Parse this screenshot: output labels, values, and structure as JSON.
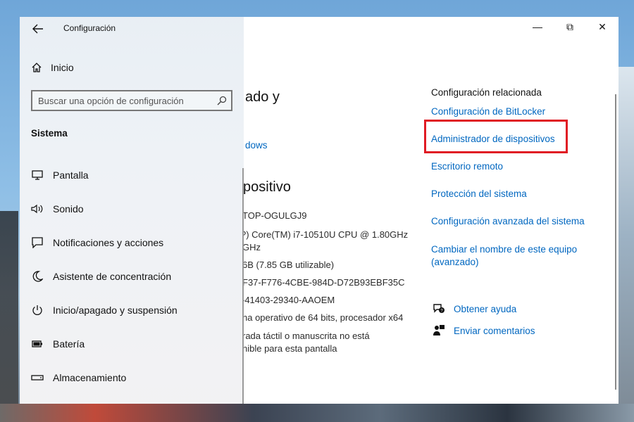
{
  "window": {
    "title": "Configuración",
    "controls": {
      "minimize": "—",
      "maximize": "⧉",
      "close": "✕"
    }
  },
  "sidebar": {
    "home_label": "Inicio",
    "search": {
      "placeholder": "Buscar una opción de configuración"
    },
    "section_title": "Sistema",
    "items": [
      {
        "label": "Pantalla",
        "icon": "monitor-icon"
      },
      {
        "label": "Sonido",
        "icon": "speaker-icon"
      },
      {
        "label": "Notificaciones y acciones",
        "icon": "notification-icon"
      },
      {
        "label": "Asistente de concentración",
        "icon": "moon-icon"
      },
      {
        "label": "Inicio/apagado y suspensión",
        "icon": "power-icon"
      },
      {
        "label": "Batería",
        "icon": "battery-icon"
      },
      {
        "label": "Almacenamiento",
        "icon": "storage-icon"
      }
    ]
  },
  "main": {
    "heading_partial": "ado y",
    "link_partial": "dows",
    "device_heading_partial": "positivo",
    "specs": [
      "TOP-OGULGJ9",
      "?) Core(TM) i7-10510U CPU @ 1.80GHz",
      "GHz",
      "6B (7.85 GB utilizable)",
      "F37-F776-4CBE-984D-D72B93EBF35C",
      "-41403-29340-AAOEM",
      "na operativo de 64 bits, procesador x64",
      "rada táctil o manuscrita no está",
      "nible para esta pantalla"
    ]
  },
  "related": {
    "title": "Configuración relacionada",
    "links": [
      "Configuración de BitLocker",
      "Administrador de dispositivos",
      "Escritorio remoto",
      "Protección del sistema",
      "Configuración avanzada del sistema",
      "Cambiar el nombre de este equipo",
      "(avanzado)"
    ],
    "highlight_color": "#e01b24"
  },
  "help": {
    "get_help": "Obtener ayuda",
    "feedback": "Enviar comentarios"
  }
}
